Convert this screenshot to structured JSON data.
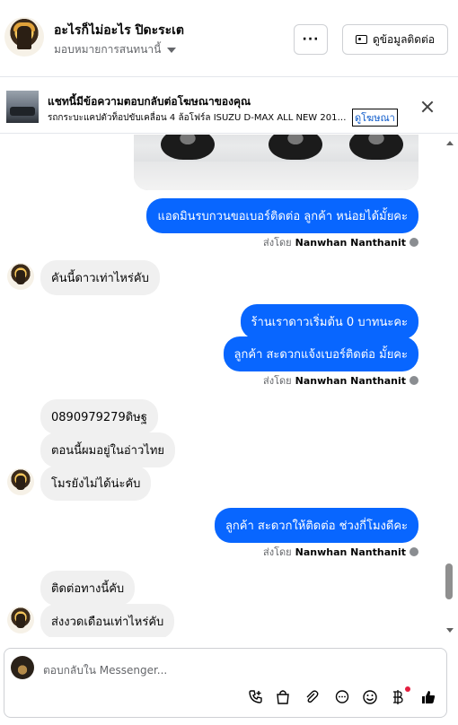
{
  "header": {
    "contact_name": "อะไรก็ไม่อะไร ปิดะระเต",
    "assign_label": "มอบหมายการสนทนานี้",
    "more_label": "···",
    "contact_info_label": "ดูข้อมูลติดต่อ"
  },
  "ad_banner": {
    "title": "แชทนี้มีข้อความตอบกลับต่อโฆษณาของคุณ",
    "subtitle": "รถกระบะแคปตัวท็อปขับเคลื่อน 4 ล้อโฟร์ล ISUZU D-MAX ALL NEW 2017...",
    "link_label": "ดูโฆษณา"
  },
  "messages": [
    {
      "id": "m1",
      "direction": "out",
      "text": "แอดมินรบกวนขอเบอร์ติดต่อ ลูกค้า หน่อยได้มั้ยคะ"
    },
    {
      "id": "s1",
      "sent_by_prefix": "ส่งโดย",
      "sent_by_name": "Nanwhan Nanthanit"
    },
    {
      "id": "m2",
      "direction": "in",
      "text": "คันนี้ดาวเท่าไหร่คับ"
    },
    {
      "id": "m3",
      "direction": "out",
      "text": "ร้านเราดาวเริ่มต้น 0 บาทนะคะ"
    },
    {
      "id": "m4",
      "direction": "out",
      "text": "ลูกค้า สะดวกแจ้งเบอร์ติดต่อ มั้ยคะ"
    },
    {
      "id": "s2",
      "sent_by_prefix": "ส่งโดย",
      "sent_by_name": "Nanwhan Nanthanit"
    },
    {
      "id": "m5",
      "direction": "in",
      "text": "0890979279ดิษฐ"
    },
    {
      "id": "m6",
      "direction": "in",
      "text": "ตอนนี้ผมอยู่ในอ่าวไทย"
    },
    {
      "id": "m7",
      "direction": "in",
      "text": "โมรยังไม่ได้น่ะคับ"
    },
    {
      "id": "m8",
      "direction": "out",
      "text": "ลูกค้า สะดวกให้ติดต่อ ช่วงกี่โมงดีคะ"
    },
    {
      "id": "s3",
      "sent_by_prefix": "ส่งโดย",
      "sent_by_name": "Nanwhan Nanthanit"
    },
    {
      "id": "m9",
      "direction": "in",
      "text": "ติดต่อทางนี้คับ"
    },
    {
      "id": "m10",
      "direction": "in",
      "text": "ส่งงวดเดือนเท่าไหร่คับ"
    }
  ],
  "composer": {
    "placeholder": "ตอบกลับใน Messenger..."
  },
  "icons": {
    "more": "more-icon",
    "contact": "contact-card-icon",
    "close": "close-icon",
    "info": "info-icon",
    "tools": [
      "add-phone-icon",
      "shopping-bag-icon",
      "attachment-icon",
      "chat-bubble-icon",
      "emoji-icon",
      "baht-icon",
      "like-icon"
    ]
  },
  "colors": {
    "outgoing_bubble": "#0866ff",
    "incoming_bubble": "#f0f0f0",
    "link": "#0a58ca",
    "notification_dot": "#e41e3f"
  }
}
